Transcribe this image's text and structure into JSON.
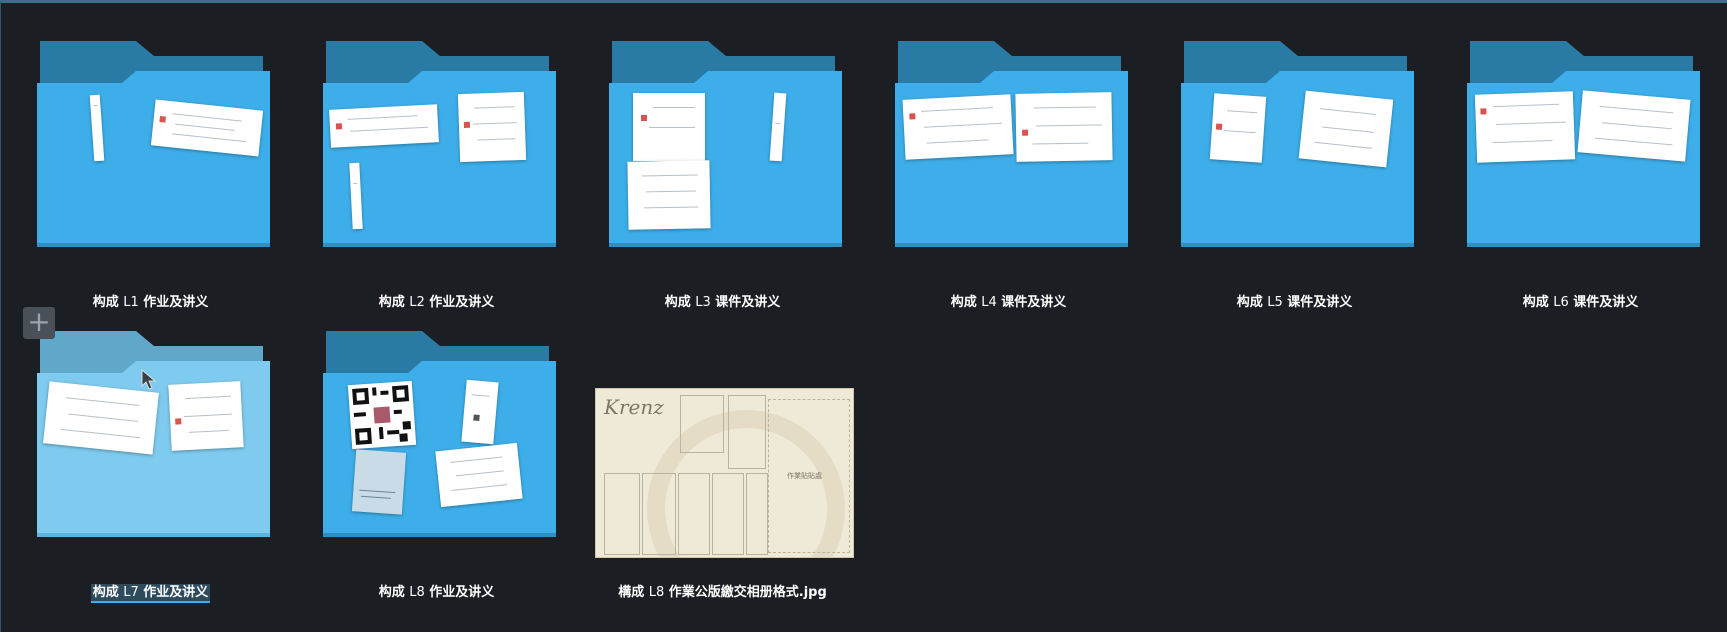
{
  "items": [
    {
      "kind": "folder",
      "prefix": "构成",
      "num": "L1",
      "suffix": "作业及讲义",
      "selected": false
    },
    {
      "kind": "folder",
      "prefix": "构成",
      "num": "L2",
      "suffix": "作业及讲义",
      "selected": false
    },
    {
      "kind": "folder",
      "prefix": "构成",
      "num": "L3",
      "suffix": "课件及讲义",
      "selected": false
    },
    {
      "kind": "folder",
      "prefix": "构成",
      "num": "L4",
      "suffix": "课件及讲义",
      "selected": false
    },
    {
      "kind": "folder",
      "prefix": "构成",
      "num": "L5",
      "suffix": "课件及讲义",
      "selected": false
    },
    {
      "kind": "folder",
      "prefix": "构成",
      "num": "L6",
      "suffix": "课件及讲义",
      "selected": false
    },
    {
      "kind": "folder",
      "prefix": "构成",
      "num": "L7",
      "suffix": "作业及讲义",
      "selected": true
    },
    {
      "kind": "folder",
      "prefix": "构成",
      "num": "L8",
      "suffix": "作业及讲义",
      "selected": false
    },
    {
      "kind": "image",
      "prefix": "構成",
      "num": "L8",
      "suffix": "作業公版繳交相册格式.jpg",
      "selected": false
    }
  ],
  "image_preview": {
    "logo_text": "Krenz",
    "box_label": "作業貼貼處"
  },
  "icons": {
    "add": "plus-icon",
    "cursor": "mouse-pointer-icon"
  },
  "colors": {
    "background": "#1b1e22",
    "folder_front": "#3daee9",
    "folder_back": "#2a7aa6",
    "folder_front_hover": "#7ecbef",
    "folder_back_hover": "#5fa8c9",
    "selection": "#3daee9"
  }
}
